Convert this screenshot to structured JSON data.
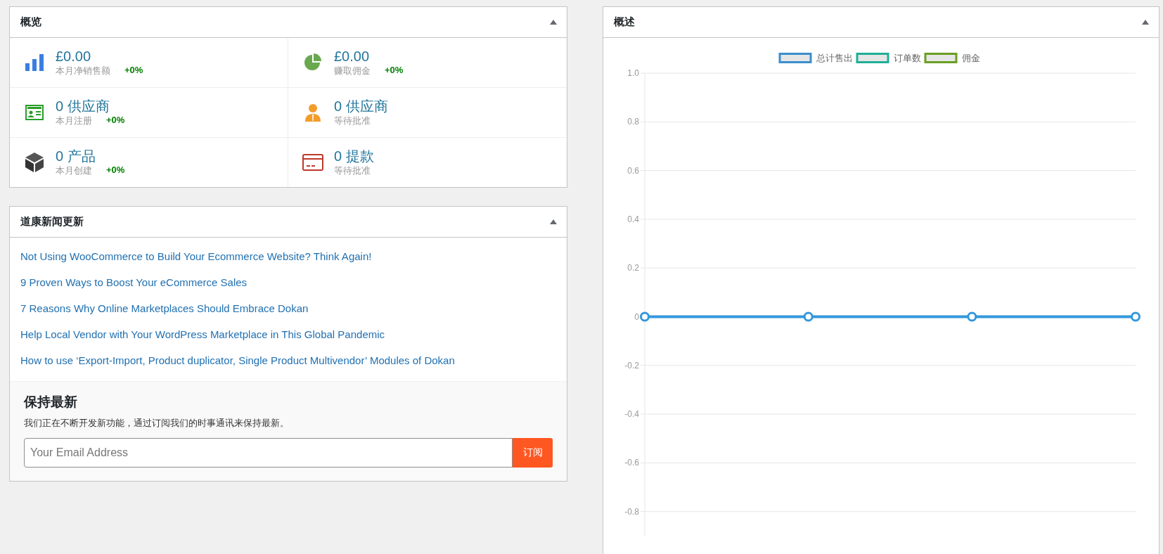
{
  "overview": {
    "title": "概览",
    "stats": [
      {
        "value": "£0.00",
        "label": "本月净销售额",
        "change": "+0%"
      },
      {
        "value": "£0.00",
        "label": "赚取佣金",
        "change": "+0%"
      },
      {
        "value": "0 供应商",
        "label": "本月注册",
        "change": "+0%"
      },
      {
        "value": "0 供应商",
        "label": "等待批准"
      },
      {
        "value": "0 产品",
        "label": "本月创建",
        "change": "+0%"
      },
      {
        "value": "0 提款",
        "label": "等待批准"
      }
    ]
  },
  "news": {
    "title": "道康新闻更新",
    "links": [
      "Not Using WooCommerce to Build Your Ecommerce Website? Think Again!",
      "9 Proven Ways to Boost Your eCommerce Sales",
      "7 Reasons Why Online Marketplaces Should Embrace Dokan",
      "Help Local Vendor with Your WordPress Marketplace in This Global Pandemic",
      "How to use ‘Export-Import, Product duplicator, Single Product Multivendor’ Modules of Dokan"
    ],
    "subscribe": {
      "title": "保持最新",
      "text": "我们正在不断开发新功能，通过订阅我们的时事通讯来保持最新。",
      "placeholder": "Your Email Address",
      "button": "订阅"
    }
  },
  "summary": {
    "title": "概述",
    "chart_data": {
      "type": "line",
      "grid": true,
      "legend": "top",
      "ylim": [
        -0.9,
        1
      ],
      "series": [
        {
          "name": "总计售出",
          "color": "#3a8fcd",
          "marker": "circle",
          "values": [
            0,
            0,
            0,
            0
          ]
        },
        {
          "name": "订单数",
          "color": "#1fae96",
          "marker": "circle",
          "values": [
            null,
            null,
            null,
            null
          ]
        },
        {
          "name": "佣金",
          "color": "#6a9e24",
          "marker": "circle",
          "values": [
            null,
            null,
            null,
            null
          ]
        }
      ],
      "yticks": [
        {
          "value": 1,
          "label": "1.0"
        },
        0.8,
        0.6,
        0.4,
        0.2,
        0,
        -0.2,
        -0.4,
        -0.6,
        -0.8
      ]
    }
  }
}
